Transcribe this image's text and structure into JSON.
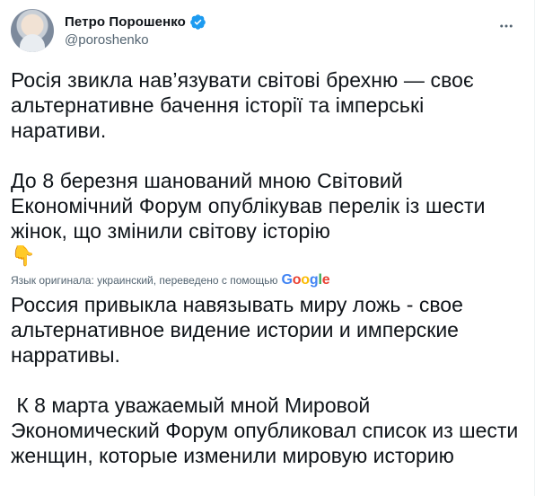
{
  "tweet": {
    "author_name": "Петро Порошенко",
    "author_handle": "@poroshenko",
    "original_paragraphs": [
      "Росія звикла нав’язувати світові брехню — своє альтернативне бачення історії та імперські наративи.",
      "До 8 березня шанований мною Світовий Економічний Форум опублікував перелік із шести жінок, що змінили світову історію"
    ],
    "emoji": "👇",
    "translation_note": "Язык оригинала: украинский, переведено с помощью",
    "translation_provider": [
      "G",
      "o",
      "o",
      "g",
      "l",
      "e"
    ],
    "translated_paragraphs": [
      "Россия привыкла навязывать миру ложь - свое альтернативное видение истории и имперские нарративы.",
      " К 8 марта уважаемый мной Мировой Экономический Форум опубликовал список из шести женщин, которые изменили мировую историю"
    ]
  },
  "colors": {
    "verified": "#1d9bf0",
    "muted": "#536471",
    "text": "#0f1419"
  },
  "icons": {
    "verified": "verified-badge-icon",
    "more": "more-horizontal-icon",
    "emoji": "backhand-index-pointing-down"
  }
}
